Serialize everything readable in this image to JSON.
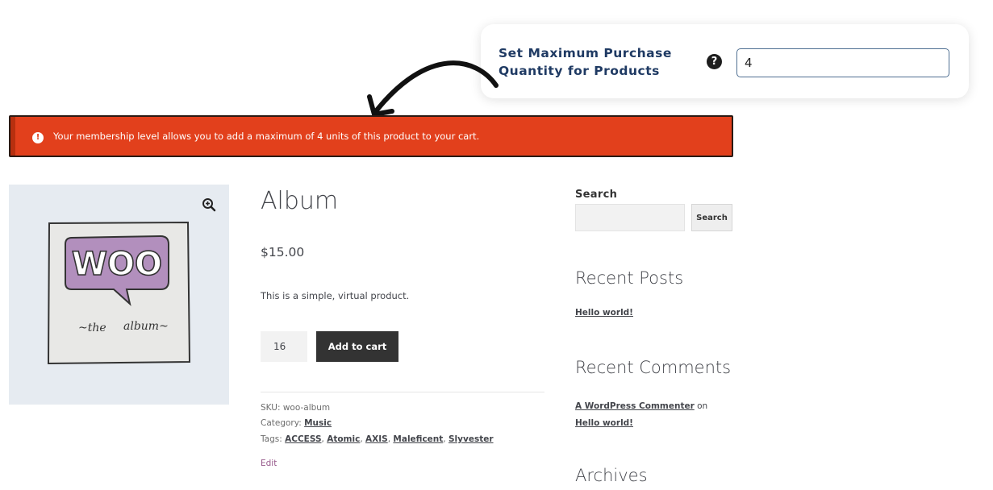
{
  "settings": {
    "label": "Set Maximum Purchase Quantity for Products",
    "help_icon": "question-circle-icon",
    "max_quantity_value": "4"
  },
  "notice": {
    "icon": "exclamation-circle-icon",
    "message": "Your membership level allows you to add a maximum of 4 units of this product to your cart.",
    "background_color": "#e2401c"
  },
  "product": {
    "image_alt": "WOO the album",
    "zoom_icon": "magnifier-zoom-icon",
    "title": "Album",
    "price": "$15.00",
    "description": "This is a simple, virtual product.",
    "quantity": "16",
    "add_to_cart_label": "Add to cart",
    "sku_label": "SKU:",
    "sku": "woo-album",
    "category_label": "Category:",
    "category": "Music",
    "tags_label": "Tags:",
    "tags": [
      "ACCESS",
      "Atomic",
      "AXIS",
      "Maleficent",
      "Slyvester"
    ],
    "edit_label": "Edit"
  },
  "sidebar": {
    "search_heading": "Search",
    "search_button_label": "Search",
    "search_value": "",
    "recent_posts_title": "Recent Posts",
    "recent_post": "Hello world!",
    "recent_comments_title": "Recent Comments",
    "comment_author": "A WordPress Commenter",
    "comment_on": "on",
    "comment_post": "Hello world!",
    "archives_title": "Archives"
  }
}
